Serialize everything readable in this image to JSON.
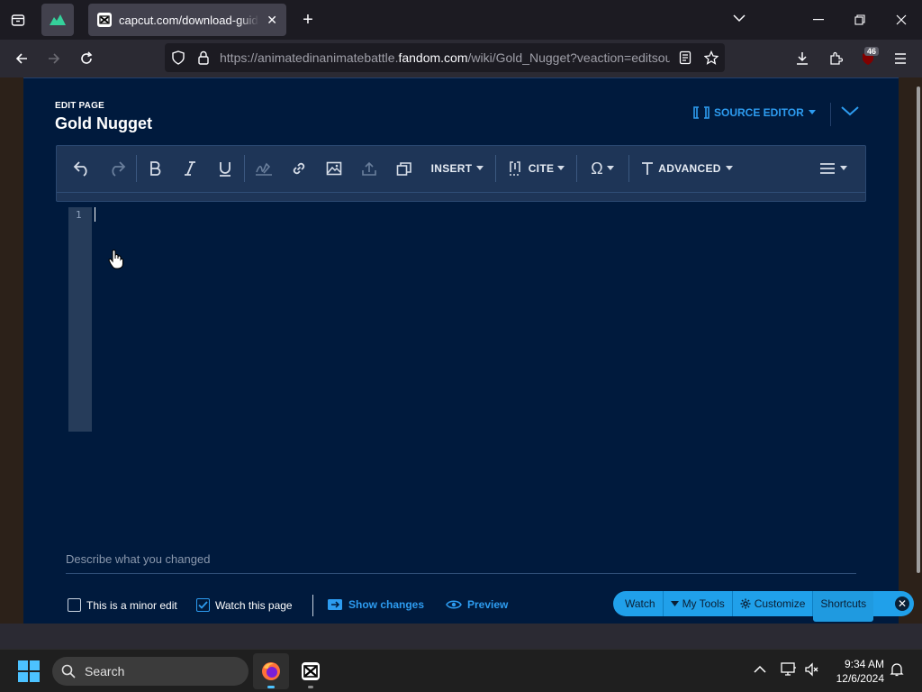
{
  "browser": {
    "active_tab_title": "capcut.com/download-guidance",
    "url_prefix": "https://animatedinanimatebattle.",
    "url_domain": "fandom.com",
    "url_path": "/wiki/Gold_Nugget?veaction=editsource",
    "extensions_badge": "46"
  },
  "editor": {
    "edit_label": "EDIT PAGE",
    "page_title": "Gold Nugget",
    "source_editor_label": "SOURCE EDITOR",
    "toolbar": {
      "insert_label": "INSERT",
      "cite_label": "CITE",
      "advanced_label": "ADVANCED"
    },
    "line_number": "1",
    "summary_placeholder": "Describe what you changed",
    "minor_edit_label": "This is a minor edit",
    "minor_edit_checked": false,
    "watch_page_label": "Watch this page",
    "watch_page_checked": true,
    "show_changes_label": "Show changes",
    "preview_label": "Preview"
  },
  "fandom_bar": {
    "watch": "Watch",
    "my_tools": "My Tools",
    "customize": "Customize",
    "shortcuts": "Shortcuts"
  },
  "taskbar": {
    "search_placeholder": "Search",
    "time": "9:34 AM",
    "date": "12/6/2024"
  },
  "colors": {
    "editor_bg": "#001a3d",
    "accent": "#2d9cf0",
    "toolbar_bg": "#1e3557",
    "fandom_bar": "#20a0ea"
  }
}
